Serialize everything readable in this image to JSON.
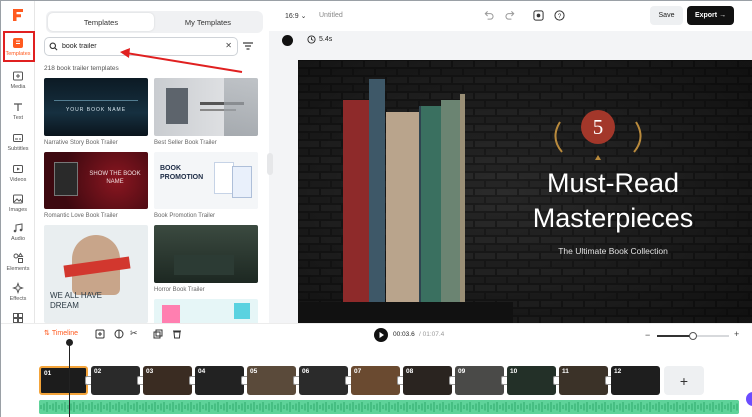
{
  "rail": {
    "items": [
      {
        "label": "Templates",
        "icon": "templates-icon",
        "active": true
      },
      {
        "label": "Media",
        "icon": "media-icon"
      },
      {
        "label": "Text",
        "icon": "text-icon"
      },
      {
        "label": "Subtitles",
        "icon": "subtitles-icon"
      },
      {
        "label": "Videos",
        "icon": "videos-icon"
      },
      {
        "label": "Images",
        "icon": "images-icon"
      },
      {
        "label": "Audio",
        "icon": "audio-icon"
      },
      {
        "label": "Elements",
        "icon": "elements-icon"
      },
      {
        "label": "Effects",
        "icon": "effects-icon"
      },
      {
        "label": "Tools",
        "icon": "tools-icon"
      }
    ]
  },
  "panel": {
    "tabs": [
      "Templates",
      "My Templates"
    ],
    "search_value": "book trailer",
    "count_text": "218 book trailer templates",
    "thumbnails": [
      {
        "label": "Narrative Story Book Trailer",
        "text": "YOUR BOOK NAME"
      },
      {
        "label": "Best Seller Book Trailer",
        "text": ""
      },
      {
        "label": "Romantic Love Book Trailer",
        "text": "SHOW THE BOOK NAME"
      },
      {
        "label": "Book Promotion Trailer",
        "text": "BOOK PROMOTION"
      },
      {
        "label": "",
        "text": "WE ALL HAVE DREAM"
      },
      {
        "label": "Horror Book Trailer",
        "text": ""
      }
    ]
  },
  "topbar": {
    "ratio": "16:9",
    "title": "Untitled",
    "save_label": "Save",
    "export_label": "Export"
  },
  "canvas": {
    "duration": "5.4s",
    "badge_number": "5",
    "title_line1": "Must-Read",
    "title_line2": "Masterpieces",
    "subtitle": "The Ultimate Book Collection"
  },
  "timeline": {
    "label": "Timeline",
    "current_time": "00:03.6",
    "total_time": "/ 01:07.4",
    "zoom_level": 0.5,
    "clips": [
      "01",
      "02",
      "03",
      "04",
      "05",
      "06",
      "07",
      "08",
      "09",
      "10",
      "11",
      "12"
    ],
    "add_label": "+"
  },
  "colors": {
    "accent": "#ff5a1f",
    "highlight": "#e02020",
    "audio": "#5fd39a",
    "export_bg": "#111111"
  }
}
